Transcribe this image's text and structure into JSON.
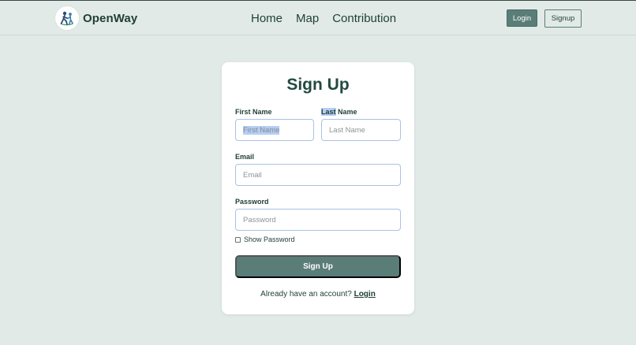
{
  "header": {
    "brand": "OpenWay",
    "logo_icon": "people-logo-icon",
    "nav": [
      {
        "label": "Home"
      },
      {
        "label": "Map"
      },
      {
        "label": "Contribution"
      }
    ],
    "login_label": "Login",
    "signup_label": "Signup"
  },
  "form": {
    "title": "Sign Up",
    "first_name": {
      "label_hl": "",
      "label_rest": "First Name",
      "placeholder": "First Name"
    },
    "last_name": {
      "label_hl": "Last",
      "label_rest": " Name",
      "placeholder": "Last Name"
    },
    "email": {
      "label": "Email",
      "placeholder": "Email"
    },
    "password": {
      "label": "Password",
      "placeholder": "Password"
    },
    "show_password_label": "Show Password",
    "show_password_checked": false,
    "submit_label": "Sign Up",
    "footer_text": "Already have an account? ",
    "footer_link": "Login"
  },
  "colors": {
    "background": "#e1eae7",
    "accent": "#5a7d78",
    "title": "#234a3f",
    "input_border": "#a9c2e6",
    "selection": "#b6cdf2"
  }
}
